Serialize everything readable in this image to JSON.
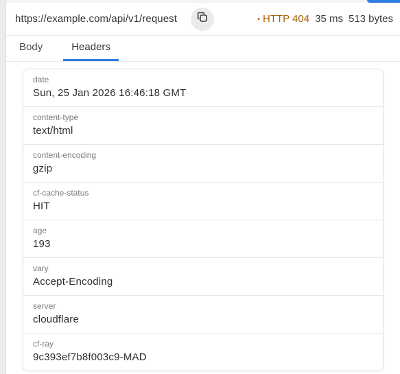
{
  "request": {
    "url": "https://example.com/api/v1/request",
    "status": "HTTP 404",
    "status_dot": "•",
    "timing": "35 ms",
    "size": "513 bytes"
  },
  "tabs": [
    {
      "label": "Body",
      "active": false
    },
    {
      "label": "Headers",
      "active": true
    }
  ],
  "headers": [
    {
      "name": "date",
      "value": "Sun, 25 Jan 2026 16:46:18 GMT"
    },
    {
      "name": "content-type",
      "value": "text/html"
    },
    {
      "name": "content-encoding",
      "value": "gzip"
    },
    {
      "name": "cf-cache-status",
      "value": "HIT"
    },
    {
      "name": "age",
      "value": "193"
    },
    {
      "name": "vary",
      "value": "Accept-Encoding"
    },
    {
      "name": "server",
      "value": "cloudflare"
    },
    {
      "name": "cf-ray",
      "value": "9c393ef7b8f003c9-MAD"
    }
  ],
  "colors": {
    "accent": "#2f7de1",
    "status_warning": "#a85f00"
  },
  "icons": {
    "copy": "copy-icon"
  }
}
